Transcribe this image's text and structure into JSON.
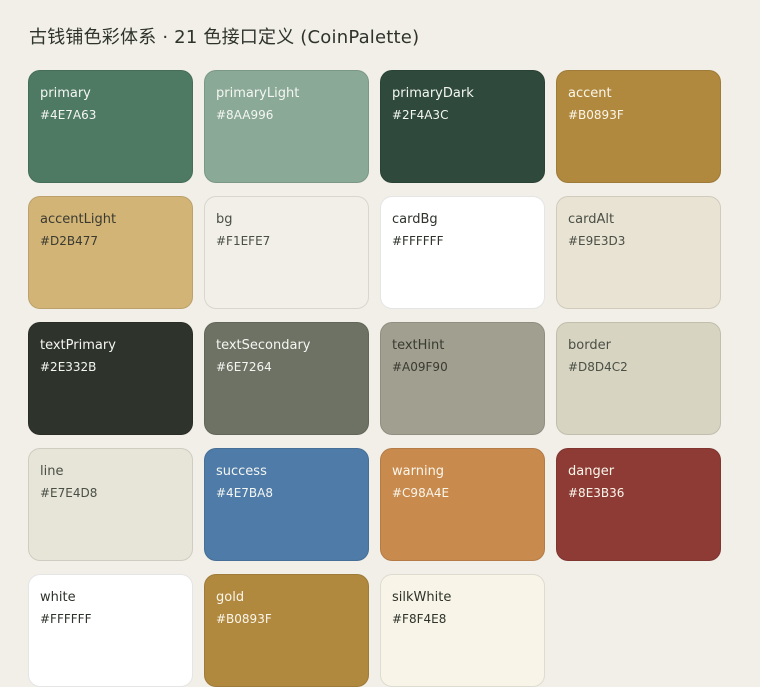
{
  "page": {
    "title": "古钱铺色彩体系 · 21 色接口定义 (CoinPalette)"
  },
  "swatches": [
    {
      "name": "primary",
      "hex": "#4E7A63",
      "text_color": "#F4F6F2"
    },
    {
      "name": "primaryLight",
      "hex": "#8AA996",
      "text_color": "#F4F6F2"
    },
    {
      "name": "primaryDark",
      "hex": "#2F4A3C",
      "text_color": "#F4F6F2"
    },
    {
      "name": "accent",
      "hex": "#B0893F",
      "text_color": "#FBF6EA"
    },
    {
      "name": "accentLight",
      "hex": "#D2B477",
      "text_color": "#3A3A30"
    },
    {
      "name": "bg",
      "hex": "#F1EFE7",
      "text_color": "#4A4F45"
    },
    {
      "name": "cardBg",
      "hex": "#FFFFFF",
      "text_color": "#2E332B"
    },
    {
      "name": "cardAlt",
      "hex": "#E9E3D3",
      "text_color": "#4A4F45"
    },
    {
      "name": "textPrimary",
      "hex": "#2E332B",
      "text_color": "#F4F6F2"
    },
    {
      "name": "textSecondary",
      "hex": "#6E7264",
      "text_color": "#F4F6F2"
    },
    {
      "name": "textHint",
      "hex": "#A09F90",
      "text_color": "#3A3A30"
    },
    {
      "name": "border",
      "hex": "#D8D4C2",
      "text_color": "#4A4F45"
    },
    {
      "name": "line",
      "hex": "#E7E4D8",
      "text_color": "#4A4F45"
    },
    {
      "name": "success",
      "hex": "#4E7BA8",
      "text_color": "#F4F6F2"
    },
    {
      "name": "warning",
      "hex": "#C98A4E",
      "text_color": "#FBF6EA"
    },
    {
      "name": "danger",
      "hex": "#8E3B36",
      "text_color": "#FBF6EA"
    },
    {
      "name": "white",
      "hex": "#FFFFFF",
      "text_color": "#2E332B"
    },
    {
      "name": "gold",
      "hex": "#B0893F",
      "text_color": "#FBF6EA"
    },
    {
      "name": "silkWhite",
      "hex": "#F8F4E8",
      "text_color": "#2E332B"
    }
  ]
}
